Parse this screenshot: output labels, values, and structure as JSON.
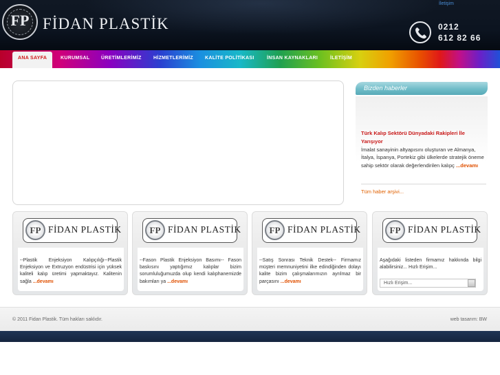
{
  "header": {
    "brand_name": "FİDAN PLASTİK",
    "emblem_glyph": "FP",
    "top_link": "İletişim",
    "phone_line1": "0212",
    "phone_line2": "612 82 66"
  },
  "nav": {
    "items": [
      {
        "label": "ANA SAYFA",
        "active": true
      },
      {
        "label": "KURUMSAL"
      },
      {
        "label": "ÜRETİMLERİMİZ"
      },
      {
        "label": "HİZMETLERİMİZ"
      },
      {
        "label": "KALİTE POLİTİKASI"
      },
      {
        "label": "İNSAN KAYNAKLARI"
      },
      {
        "label": "İLETİŞİM"
      }
    ]
  },
  "news": {
    "header": "Bizden haberler",
    "title": "Türk Kalıp Sektörü Dünyadaki Rakipleri İle Yarışıyor",
    "body": "İmalat sanayinin altyapısını oluşturan ve Almanya, İtalya, İspanya, Portekiz gibi ülkelerde stratejik öneme sahip sektör olarak değerlendirilen kalıpç",
    "more": "...devamı",
    "archive": "Tüm haber arşivi..."
  },
  "boxes": [
    {
      "logo_name": "FİDAN PLASTİK",
      "text": "--Plastik Enjeksiyon Kalıpçılığı--Plastik Enjeksiyon ve Extruzyon endüstrisi için yüksek kaliteli kalıp üretimi yapmaktayız. Kalitenin sağla",
      "more": "...devamı"
    },
    {
      "logo_name": "FİDAN PLASTİK",
      "text": "--Fason Plastik Enjeksiyon Basımı-- Fason baskısını yaptığımız kalıplar bizim sorumluluğumuzda olup kendi kalıphanemizde bakımları ya",
      "more": "...devamı"
    },
    {
      "logo_name": "FİDAN PLASTİK",
      "text": "--Satış Sonrası Teknik Destek-- Firmamız müşteri memnuniyetini ilke edindiğinden dolayı kalite bizim çalışmalarımızın ayrılmaz bir parçasını",
      "more": "...devamı"
    },
    {
      "logo_name": "FİDAN PLASTİK",
      "text": "Aşağıdaki listeden firmamız hakkında bilgi alabilirsiniz... Hızlı Erişim...",
      "select_value": "Hızlı Erişim..."
    }
  ],
  "footer": {
    "copyright": "© 2011 Fidan Plastik. Tüm hakları saklıdır.",
    "credit": "web tasarım: BW"
  },
  "colors": {
    "accent_red": "#d01818",
    "more_orange": "#e05000",
    "news_teal": "#6fbcc8",
    "header_dark": "#0c1420",
    "footer_bar": "#1f3454"
  },
  "icons": [
    "phone-icon",
    "logo-emblem-icon",
    "search-arrow-icon"
  ]
}
